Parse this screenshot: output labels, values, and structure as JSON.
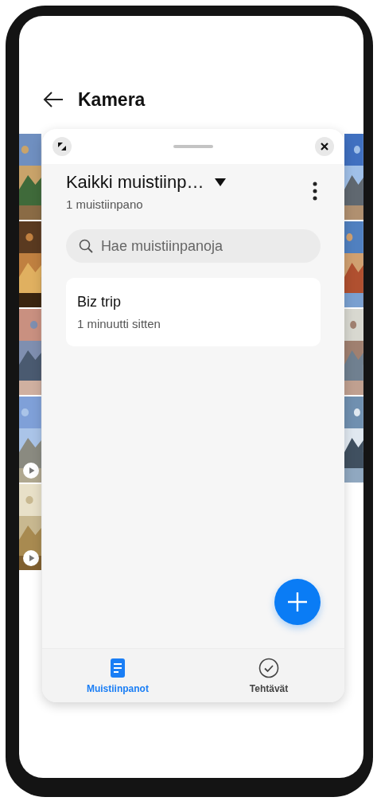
{
  "header": {
    "title": "Kamera"
  },
  "gallery": {
    "left": [
      {
        "kind": "picture",
        "video": false
      },
      {
        "kind": "picture",
        "video": false
      },
      {
        "kind": "picture",
        "video": false
      },
      {
        "kind": "picture",
        "video": true
      },
      {
        "kind": "picture",
        "video": true
      }
    ],
    "right": [
      {
        "kind": "picture",
        "video": false
      },
      {
        "kind": "picture",
        "video": false
      },
      {
        "kind": "picture",
        "video": false
      },
      {
        "kind": "picture",
        "video": false
      }
    ]
  },
  "floating_window": {
    "title": "Kaikki muistiinp…",
    "subtitle": "1 muistiinpano",
    "search": {
      "placeholder": "Hae muistiinpanoja"
    },
    "notes": [
      {
        "title": "Biz trip",
        "time": "1 minuutti sitten"
      }
    ],
    "bottom_tabs": [
      {
        "kind": "notes",
        "label": "Muistiinpanot",
        "selected": true
      },
      {
        "kind": "tasks",
        "label": "Tehtävät",
        "selected": false
      }
    ]
  }
}
